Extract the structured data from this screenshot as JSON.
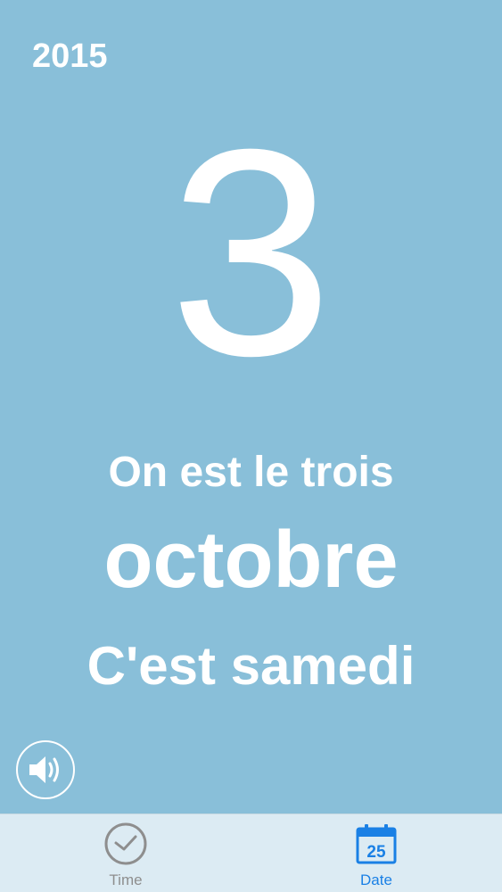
{
  "calendar": {
    "year": "2015",
    "day_number": "3",
    "day_sentence": "On est le trois",
    "month": "octobre",
    "weekday_sentence": "C'est samedi"
  },
  "speaker": {
    "icon": "speaker-icon"
  },
  "tabbar": {
    "tabs": [
      {
        "label": "Time",
        "icon": "clock-icon",
        "active": false
      },
      {
        "label": "Date",
        "icon": "calendar-icon",
        "active": true
      }
    ],
    "calendar_icon_number": "25"
  },
  "colors": {
    "background": "#89bfd9",
    "text": "#ffffff",
    "tabbar_background": "#dcebf3",
    "active_tab": "#1a80e5",
    "inactive_tab": "#8e8e8e"
  }
}
